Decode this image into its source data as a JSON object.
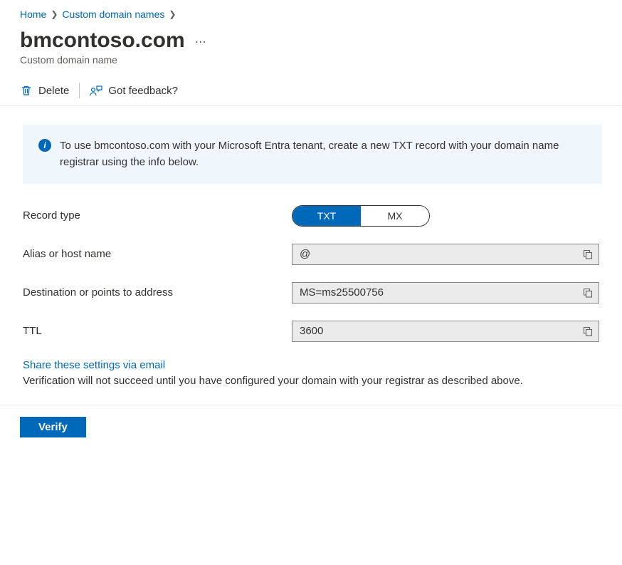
{
  "breadcrumb": {
    "home": "Home",
    "custom_domains": "Custom domain names"
  },
  "header": {
    "title": "bmcontoso.com",
    "subtitle": "Custom domain name"
  },
  "commands": {
    "delete": "Delete",
    "feedback": "Got feedback?"
  },
  "info": {
    "text": "To use bmcontoso.com with your Microsoft Entra tenant, create a new TXT record with your domain name registrar using the info below."
  },
  "form": {
    "record_type_label": "Record type",
    "segment_txt": "TXT",
    "segment_mx": "MX",
    "alias_label": "Alias or host name",
    "alias_value": "@",
    "dest_label": "Destination or points to address",
    "dest_value": "MS=ms25500756",
    "ttl_label": "TTL",
    "ttl_value": "3600"
  },
  "share": {
    "link": "Share these settings via email",
    "helper": "Verification will not succeed until you have configured your domain with your registrar as described above."
  },
  "footer": {
    "verify": "Verify"
  }
}
